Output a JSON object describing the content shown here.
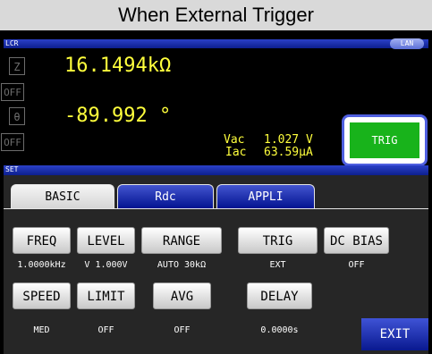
{
  "caption": "When External Trigger",
  "header": {
    "tag": "LCR",
    "lan": "LAN"
  },
  "measurement": {
    "param1": "Z",
    "param1_value": "16.1494kΩ",
    "param2": "OFF",
    "param3": "θ",
    "param3_value": "-89.992 °",
    "param4": "OFF",
    "vac_label": "Vac",
    "vac_value": "1.027 V",
    "iac_label": "Iac",
    "iac_value": "63.59μA",
    "trig_button": "TRIG"
  },
  "set_bar": "SET",
  "tabs": [
    {
      "label": "BASIC"
    },
    {
      "label": "Rdc"
    },
    {
      "label": "APPLI"
    }
  ],
  "settings": [
    {
      "label": "FREQ",
      "value": "1.0000kHz"
    },
    {
      "label": "LEVEL",
      "value": "V 1.000V"
    },
    {
      "label": "RANGE",
      "value": "AUTO  30kΩ"
    },
    {
      "label": "TRIG",
      "value": "EXT"
    },
    {
      "label": "DC BIAS",
      "value": "OFF"
    },
    {
      "label": "SPEED",
      "value": "MED"
    },
    {
      "label": "LIMIT",
      "value": "OFF"
    },
    {
      "label": "AVG",
      "value": "OFF"
    },
    {
      "label": "DELAY",
      "value": "0.0000s"
    }
  ],
  "exit_button": "EXIT",
  "colors": {
    "value_text": "#ffff3c",
    "trig_green": "#18b31b",
    "tab_blue": "#00108e",
    "highlight_frame": "#4f5fe0"
  }
}
